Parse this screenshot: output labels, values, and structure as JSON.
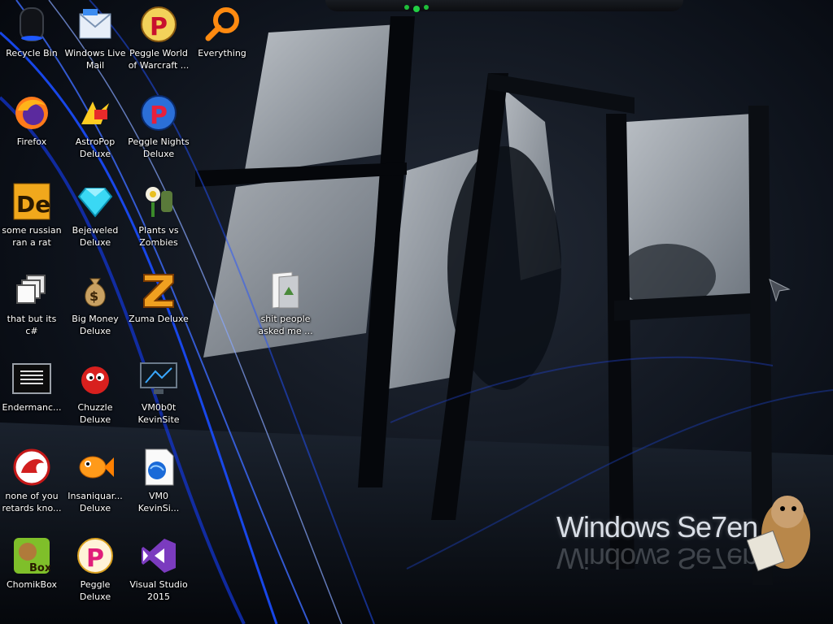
{
  "desktop": {
    "icons": [
      {
        "label": "Recycle Bin",
        "icon": "recycle-bin-icon"
      },
      {
        "label": "Windows Live\nMail",
        "icon": "windows-live-mail-icon"
      },
      {
        "label": "Peggle World\nof Warcraft ...",
        "icon": "peggle-world-of-warcraft-icon"
      },
      {
        "label": "Everything",
        "icon": "everything-search-icon"
      },
      {
        "label": "Firefox",
        "icon": "firefox-icon"
      },
      {
        "label": "AstroPop\nDeluxe",
        "icon": "astropop-icon"
      },
      {
        "label": "Peggle Nights\nDeluxe",
        "icon": "peggle-nights-icon"
      },
      {
        "label": "some russian\nran a rat",
        "icon": "de-app-icon"
      },
      {
        "label": "Bejeweled\nDeluxe",
        "icon": "bejeweled-icon"
      },
      {
        "label": "Plants vs\nZombies",
        "icon": "plants-vs-zombies-icon"
      },
      {
        "label": "that but its c#",
        "icon": "window-stack-icon"
      },
      {
        "label": "Big Money\nDeluxe",
        "icon": "money-bag-icon"
      },
      {
        "label": "Zuma Deluxe",
        "icon": "zuma-icon"
      },
      {
        "label": "shit people\nasked me ...",
        "icon": "folder-icon"
      },
      {
        "label": "Endermanc...",
        "icon": "console-window-icon"
      },
      {
        "label": "Chuzzle\nDeluxe",
        "icon": "chuzzle-icon"
      },
      {
        "label": "VM0b0t\nKevinSite",
        "icon": "monitor-icon"
      },
      {
        "label": "none of you\nretards kno...",
        "icon": "red-bird-icon"
      },
      {
        "label": "Insaniquar...\nDeluxe",
        "icon": "insaniquarium-fish-icon"
      },
      {
        "label": "VM0\nKevinSi...",
        "icon": "globe-document-icon"
      },
      {
        "label": "ChomikBox",
        "icon": "chomikbox-icon"
      },
      {
        "label": "Peggle Deluxe",
        "icon": "peggle-deluxe-icon"
      },
      {
        "label": "Visual Studio\n2015",
        "icon": "visual-studio-icon"
      }
    ]
  },
  "wallpaper": {
    "branding_text": "Windows Se7en",
    "accent_blue": "#1a4dff",
    "background_dark": "#0b0f18"
  }
}
